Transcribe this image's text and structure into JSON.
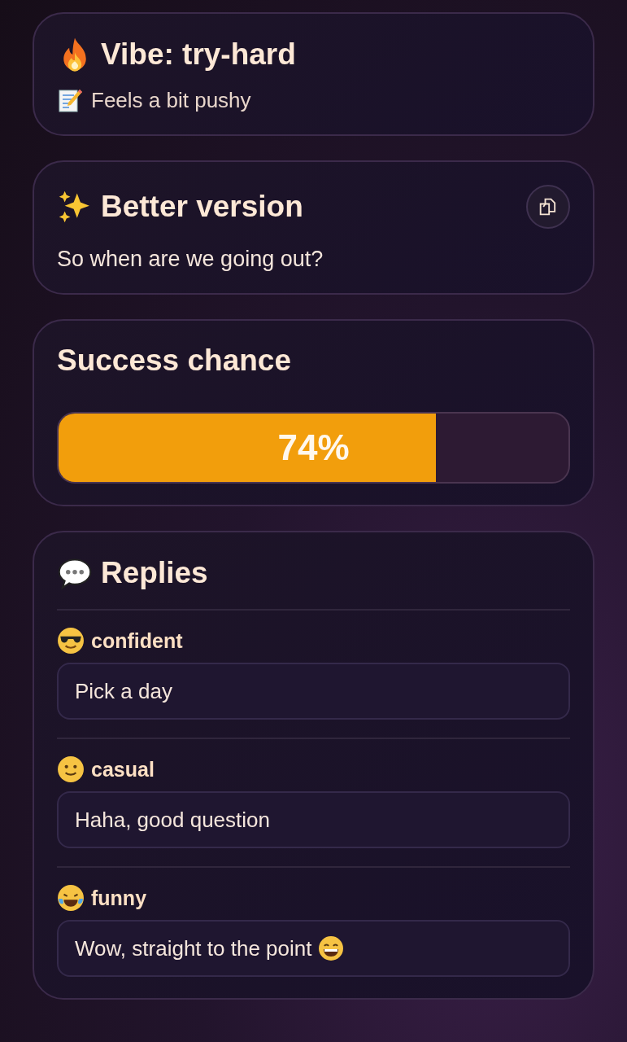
{
  "vibe": {
    "title": "Vibe: try-hard",
    "note": "Feels a bit pushy"
  },
  "better": {
    "title": "Better version",
    "text": "So when are we going out?"
  },
  "success": {
    "title": "Success chance",
    "level": 0.74,
    "reading": "74%"
  },
  "replies": {
    "title": "Replies",
    "items": [
      {
        "kind": "cool",
        "tone": "confident",
        "text": "Pick a day",
        "grin_at_end": false
      },
      {
        "kind": "smile",
        "tone": "casual",
        "text": "Haha, good question",
        "grin_at_end": false
      },
      {
        "kind": "laugh",
        "tone": "funny",
        "text": "Wow, straight to the point",
        "grin_at_end": true
      }
    ]
  }
}
